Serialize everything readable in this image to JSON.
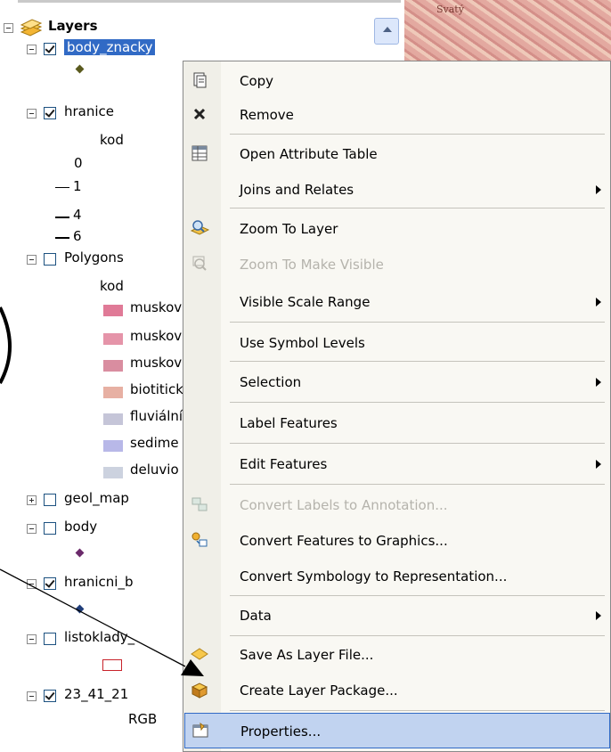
{
  "toc": {
    "root_label": "Layers",
    "layers": [
      {
        "name": "body_znacky_shown",
        "label": "body_znacky",
        "checked": true
      },
      {
        "name": "hranice",
        "label": "hranice",
        "checked": true,
        "field": "kod",
        "classes": [
          "0",
          "1",
          "4",
          "6"
        ]
      },
      {
        "name": "polygons",
        "label": "Polygons",
        "checked": false,
        "field": "kod",
        "classes": [
          "muskovi",
          "muskovi",
          "muskovi",
          "biotitick",
          "fluviální",
          "sedime",
          "deluvio"
        ]
      },
      {
        "name": "geol-map",
        "label": "geol_map",
        "checked": false
      },
      {
        "name": "body",
        "label": "body",
        "checked": false
      },
      {
        "name": "hranicni-b",
        "label": "hranicni_b",
        "checked": true
      },
      {
        "name": "listoklady",
        "label": "listoklady_",
        "checked": false
      },
      {
        "name": "raster-23-41-21",
        "label": "23_41_21",
        "checked": true,
        "sublabel": "RGB"
      }
    ]
  },
  "map": {
    "label": "Svatý"
  },
  "context_menu": {
    "items": [
      {
        "label": "Copy",
        "icon": "copy-icon",
        "enabled": true
      },
      {
        "label": "Remove",
        "icon": "remove-icon",
        "enabled": true
      },
      {
        "label": "Open Attribute Table",
        "icon": "attribute-table-icon",
        "enabled": true
      },
      {
        "label": "Joins and Relates",
        "icon": "",
        "enabled": true,
        "submenu": true
      },
      {
        "label": "Zoom To Layer",
        "icon": "zoom-to-layer-icon",
        "enabled": true
      },
      {
        "label": "Zoom To Make Visible",
        "icon": "zoom-visible-icon",
        "enabled": false
      },
      {
        "label": "Visible Scale Range",
        "icon": "",
        "enabled": true,
        "submenu": true
      },
      {
        "label": "Use Symbol Levels",
        "icon": "",
        "enabled": true
      },
      {
        "label": "Selection",
        "icon": "",
        "enabled": true,
        "submenu": true
      },
      {
        "label": "Label Features",
        "icon": "",
        "enabled": true
      },
      {
        "label": "Edit Features",
        "icon": "",
        "enabled": true,
        "submenu": true
      },
      {
        "label": "Convert Labels to Annotation...",
        "icon": "convert-labels-icon",
        "enabled": false
      },
      {
        "label": "Convert Features to Graphics...",
        "icon": "convert-graphics-icon",
        "enabled": true
      },
      {
        "label": "Convert Symbology to Representation...",
        "icon": "",
        "enabled": true
      },
      {
        "label": "Data",
        "icon": "",
        "enabled": true,
        "submenu": true
      },
      {
        "label": "Save As Layer File...",
        "icon": "save-layer-icon",
        "enabled": true
      },
      {
        "label": "Create Layer Package...",
        "icon": "layer-package-icon",
        "enabled": true
      },
      {
        "label": "Properties...",
        "icon": "properties-icon",
        "enabled": true,
        "highlighted": true
      }
    ]
  },
  "colors": {
    "selection": "#316ac5",
    "menu_bg": "#f9f8f3",
    "highlight": "#c1d3f0",
    "polygon_swatches": [
      "#e07a97",
      "#e594a9",
      "#d98da0",
      "#e7b0a3",
      "#c5c5d8",
      "#b8b8e8",
      "#ccd2df"
    ],
    "hranice_dot": "#5a5a1e",
    "body_dot": "#6b2a6b",
    "hranicni_dot": "#1f3d7a"
  }
}
